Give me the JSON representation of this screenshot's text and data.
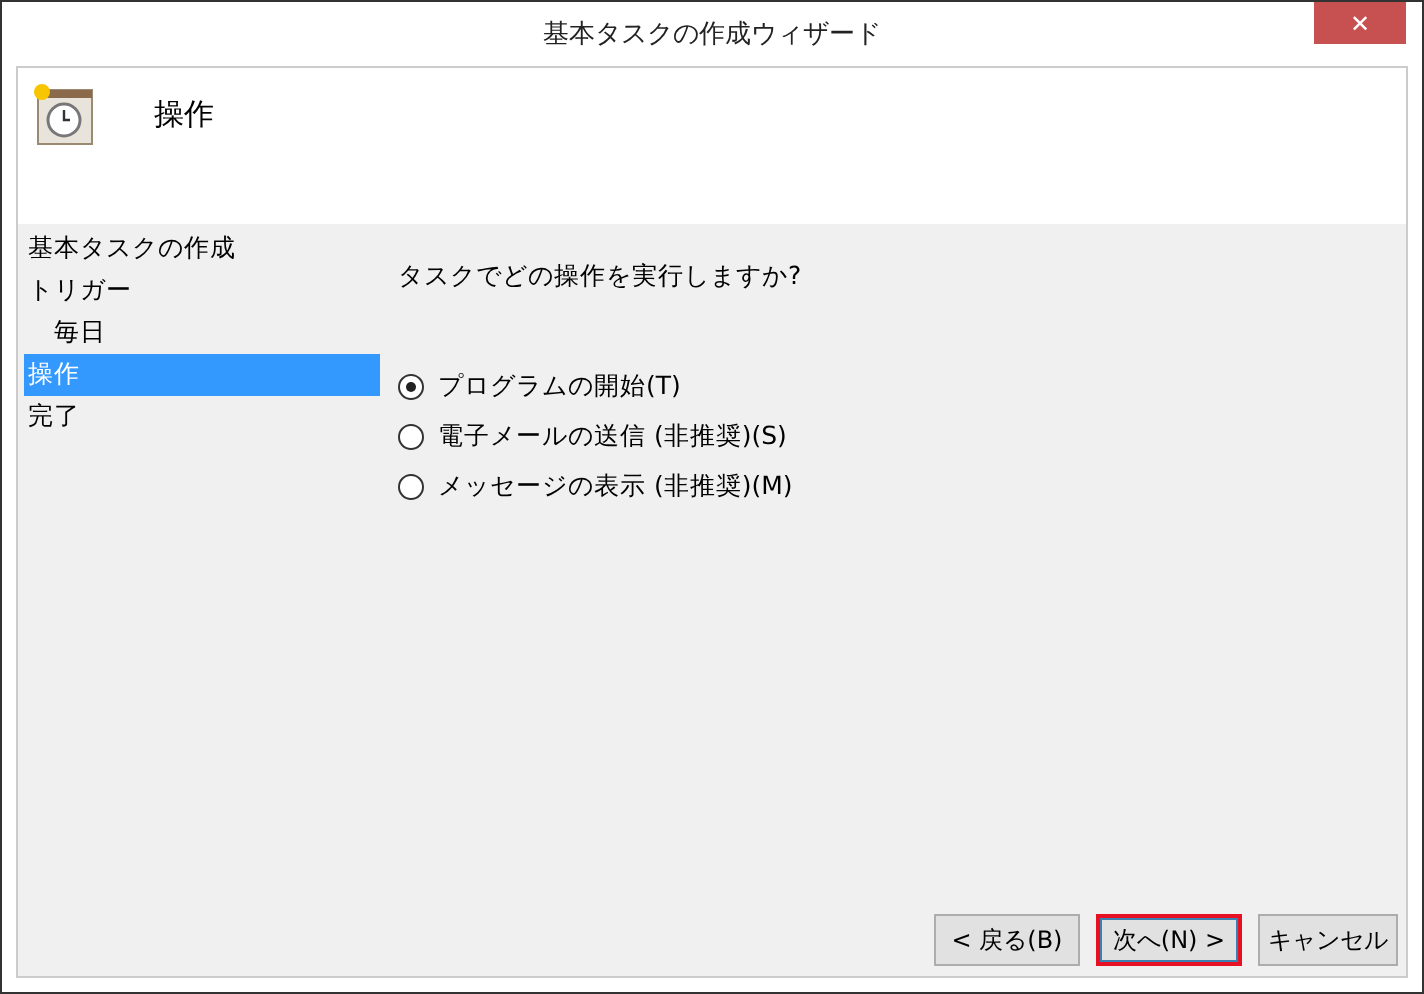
{
  "window": {
    "title": "基本タスクの作成ウィザード",
    "close": "✕"
  },
  "header": {
    "title": "操作"
  },
  "steps": [
    {
      "label": "基本タスクの作成",
      "selected": false
    },
    {
      "label": "トリガー",
      "selected": false,
      "children": [
        {
          "label": "毎日",
          "selected": false
        }
      ]
    },
    {
      "label": "操作",
      "selected": true
    },
    {
      "label": "完了",
      "selected": false
    }
  ],
  "question": "タスクでどの操作を実行しますか?",
  "options": [
    {
      "label": "プログラムの開始(T)",
      "selected": true
    },
    {
      "label": "電子メールの送信 (非推奨)(S)",
      "selected": false
    },
    {
      "label": "メッセージの表示 (非推奨)(M)",
      "selected": false
    }
  ],
  "buttons": [
    {
      "label": "< 戻る(B)",
      "highlighted": false
    },
    {
      "label": "次へ(N) >",
      "highlighted": true
    },
    {
      "label": "キャンセル",
      "highlighted": false
    }
  ]
}
